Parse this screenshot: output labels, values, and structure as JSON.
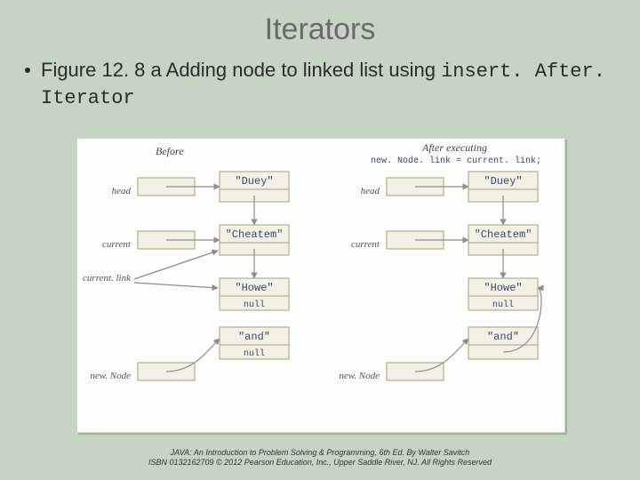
{
  "title": "Iterators",
  "bullet": {
    "prefix": "Figure 12. 8 a Adding node to linked list using ",
    "code": "insert. After. Iterator"
  },
  "diagram": {
    "left_header": "Before",
    "right_header": "After executing",
    "right_code": "new. Node. link = current. link;",
    "labels": {
      "head": "head",
      "current": "current",
      "current_link": "current. link",
      "newNode": "new. Node"
    },
    "values": {
      "duey": "\"Duey\"",
      "cheatem": "\"Cheatem\"",
      "howe": "\"Howe\"",
      "and": "\"and\"",
      "null": "null"
    }
  },
  "credit_line1": "JAVA: An Introduction to Problem Solving & Programming, 6th Ed. By Walter Savitch",
  "credit_line2": "ISBN 0132162709 © 2012 Pearson Education, Inc., Upper Saddle River, NJ. All Rights Reserved"
}
